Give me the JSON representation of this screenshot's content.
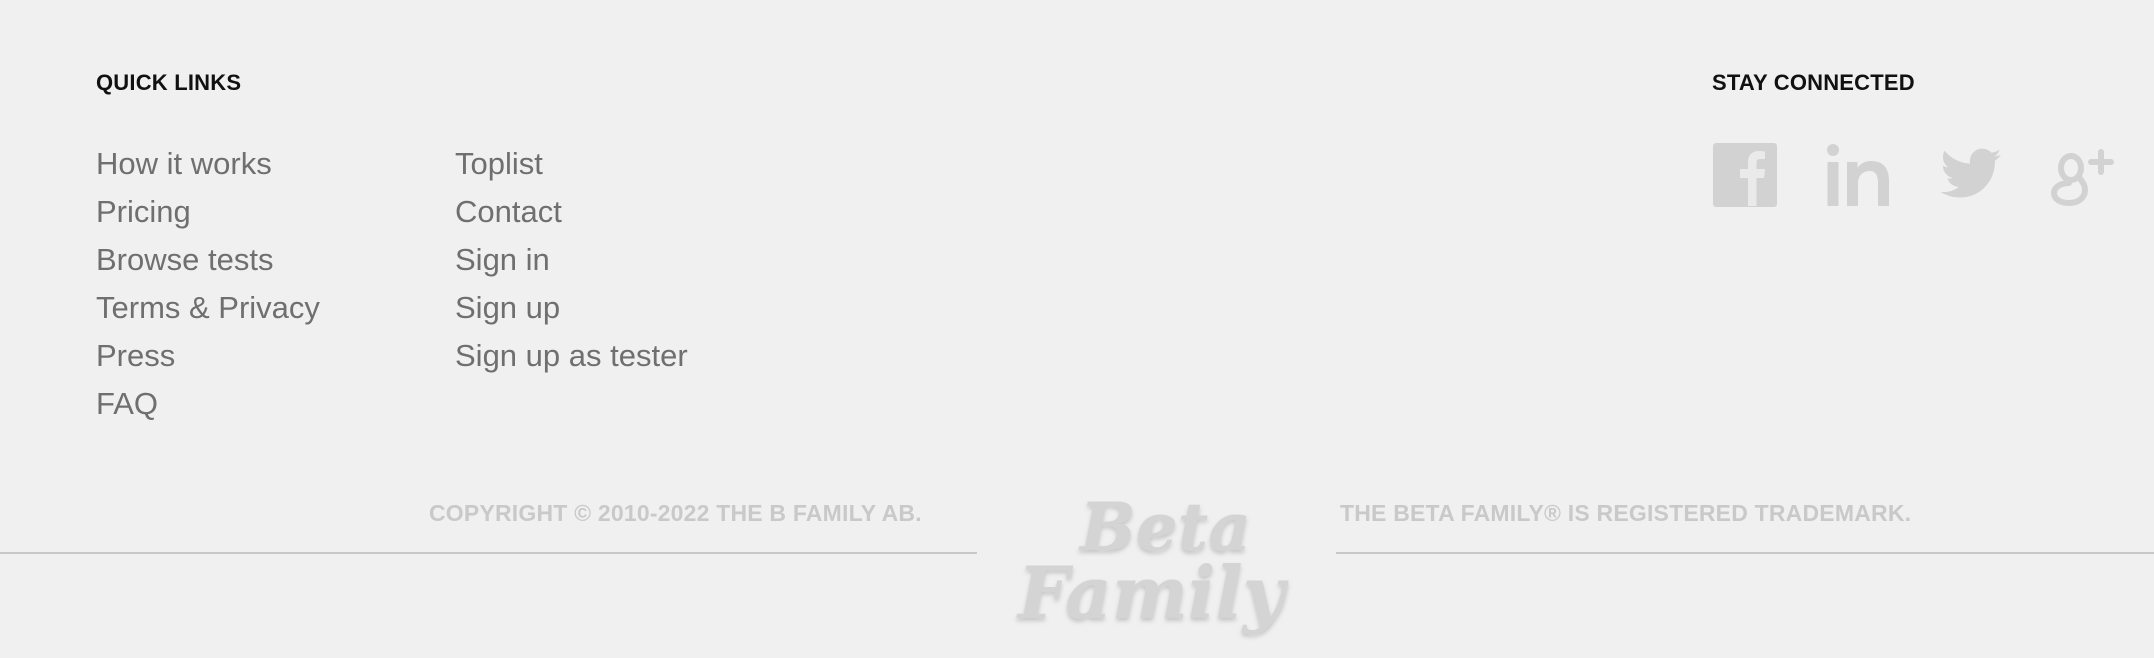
{
  "quick_links": {
    "heading": "QUICK LINKS",
    "column_1": [
      "How it works",
      "Pricing",
      "Browse tests",
      "Terms & Privacy",
      "Press",
      "FAQ"
    ],
    "column_2": [
      "Toplist",
      "Contact",
      "Sign in",
      "Sign up",
      "Sign up as tester"
    ]
  },
  "stay_connected": {
    "heading": "STAY CONNECTED",
    "icons": [
      "facebook-icon",
      "linkedin-icon",
      "twitter-icon",
      "google-plus-icon"
    ]
  },
  "footer": {
    "copyright": "COPYRIGHT © 2010-2022 THE B FAMILY AB.",
    "trademark": "THE BETA FAMILY® IS REGISTERED TRADEMARK.",
    "logo_text_line1": "Beta",
    "logo_text_line2": "Family"
  },
  "colors": {
    "background": "#f0f0f0",
    "heading": "#111111",
    "link": "#6f6f6f",
    "muted": "#c9c9c9",
    "icon": "#d2d2d2"
  }
}
